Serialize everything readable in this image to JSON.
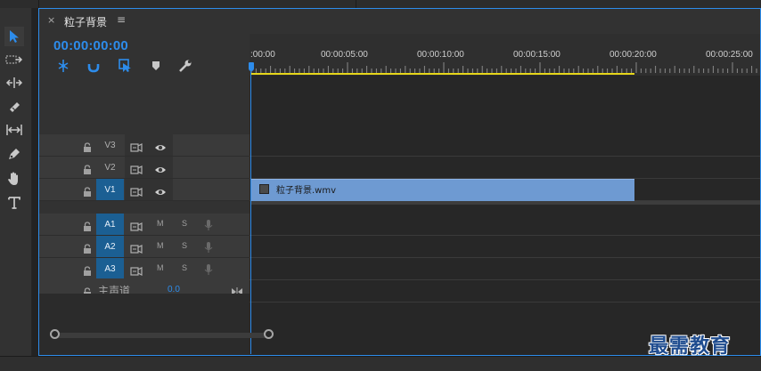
{
  "sequence": {
    "tab_close": "×",
    "tab_title": "粒子背景",
    "tab_menu": "≡",
    "timecode": "00:00:00:00"
  },
  "header_tools": [
    {
      "icon": "snap-icon"
    },
    {
      "icon": "link-icon"
    },
    {
      "icon": "add-marker-select-icon"
    },
    {
      "icon": "marker-icon"
    },
    {
      "icon": "wrench-icon"
    }
  ],
  "ruler": {
    "labels": [
      ":00:00",
      "00:00:05:00",
      "00:00:10:00",
      "00:00:15:00",
      "00:00:20:00",
      "00:00:25:00"
    ]
  },
  "tracks": {
    "video": [
      {
        "name": "V3",
        "targeted": false
      },
      {
        "name": "V2",
        "targeted": false
      },
      {
        "name": "V1",
        "targeted": true
      }
    ],
    "audio": [
      {
        "name": "A1",
        "mute": "M",
        "solo": "S"
      },
      {
        "name": "A2",
        "mute": "M",
        "solo": "S"
      },
      {
        "name": "A3",
        "mute": "M",
        "solo": "S"
      }
    ],
    "master": {
      "label": "主声道",
      "volume": "0.0"
    }
  },
  "clip": {
    "name": "粒子背景.wmv"
  },
  "watermark": "最需教育",
  "colors": {
    "accent": "#2d8ceb",
    "clip": "#6e9ad2",
    "workarea": "#e6d61a"
  }
}
